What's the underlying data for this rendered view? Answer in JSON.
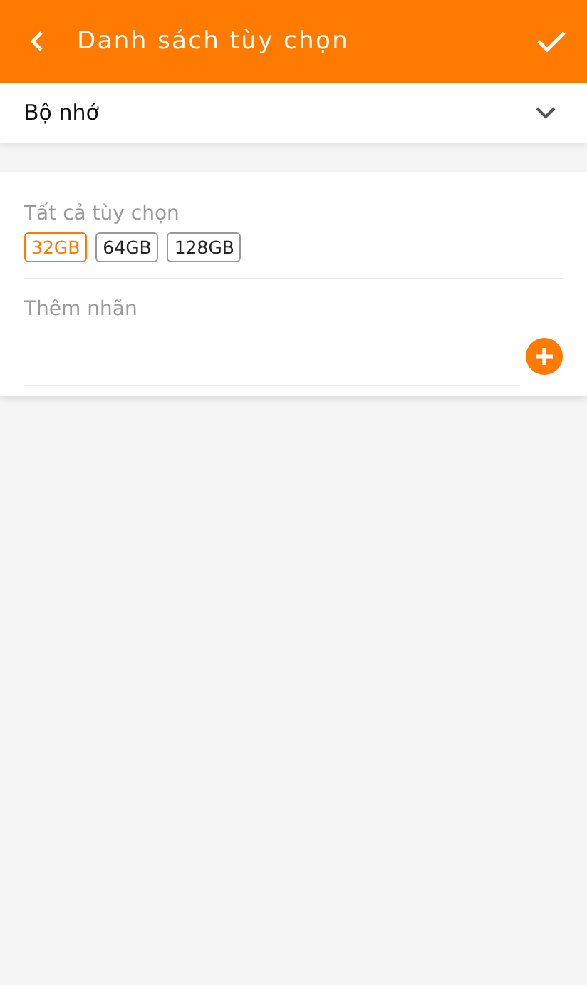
{
  "header": {
    "title": "Danh sách tùy chọn"
  },
  "category": {
    "value": "Bộ nhớ"
  },
  "options": {
    "label": "Tất cả tùy chọn",
    "chips": [
      {
        "label": "32GB",
        "selected": true
      },
      {
        "label": "64GB",
        "selected": false
      },
      {
        "label": "128GB",
        "selected": false
      }
    ]
  },
  "tag_input": {
    "placeholder": "Thêm nhãn"
  }
}
